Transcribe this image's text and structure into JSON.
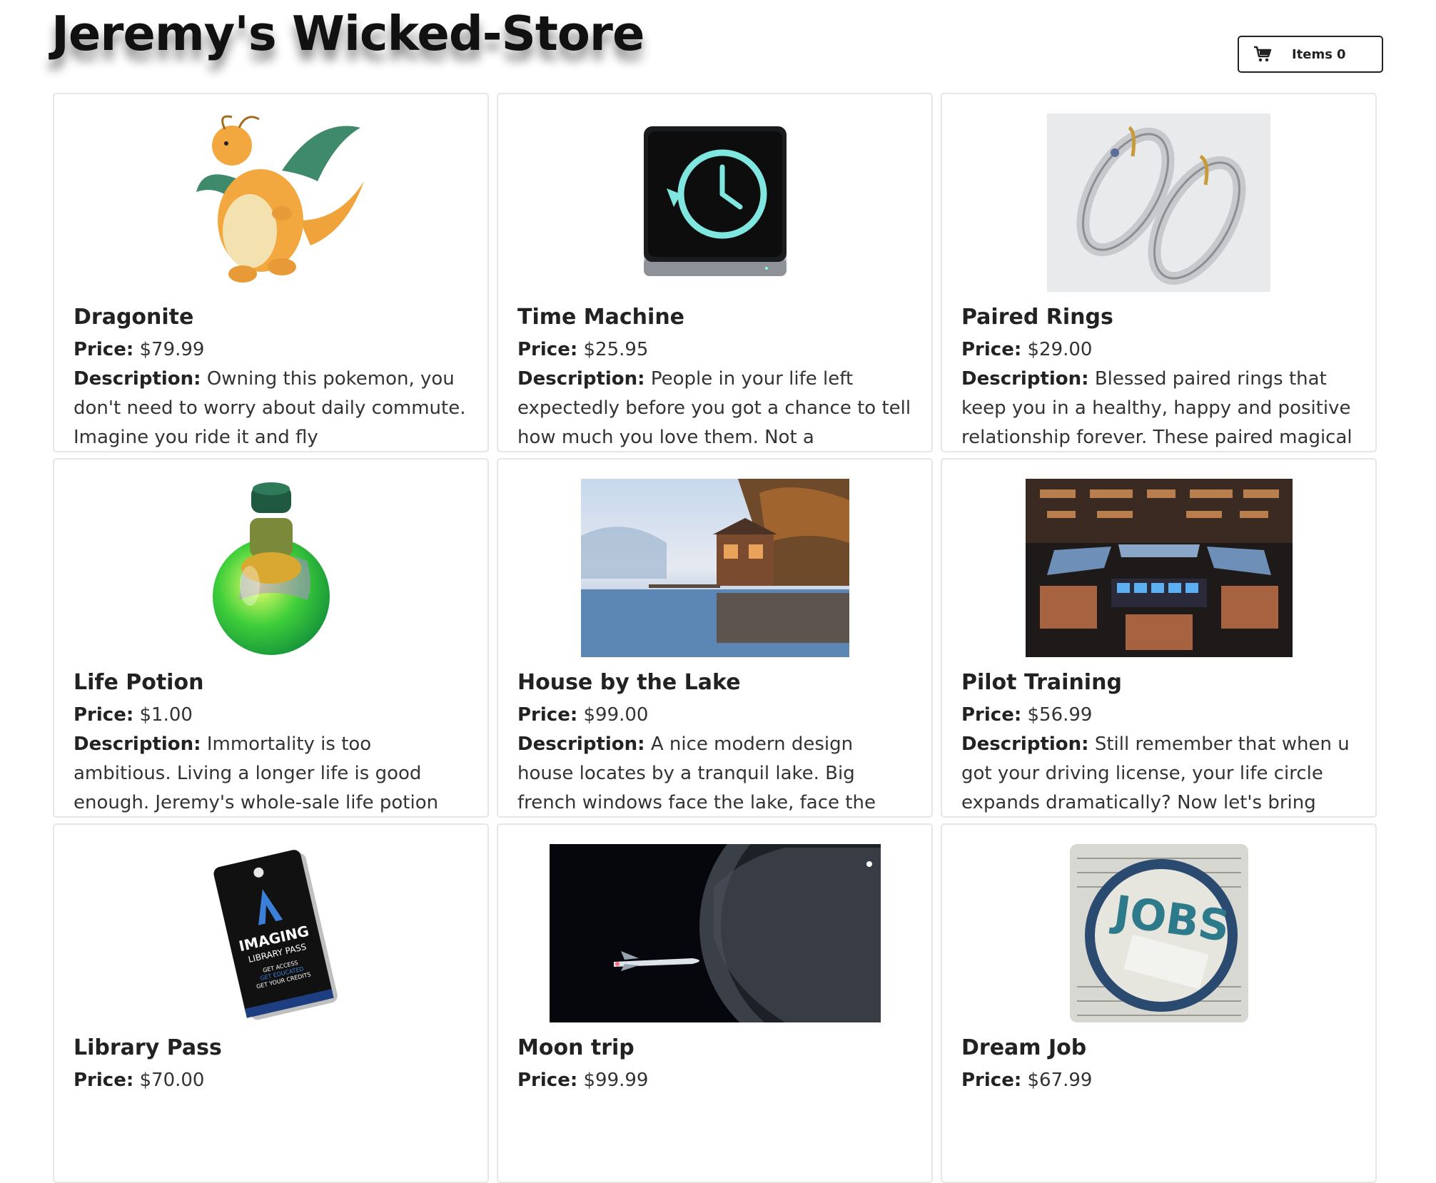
{
  "header": {
    "title": "Jeremy's Wicked-Store",
    "cart": {
      "icon": "cart-icon",
      "label": "Items",
      "count": "0"
    }
  },
  "labels": {
    "price": "Price:",
    "description": "Description:"
  },
  "products": [
    {
      "name": "Dragonite",
      "price": "$79.99",
      "description": "Owning this pokemon, you don't need to worry about daily commute. Imagine you ride it and fly",
      "image": "dragonite-image"
    },
    {
      "name": "Time Machine",
      "price": "$25.95",
      "description": "People in your life left expectedly before you got a chance to tell how much you love them. Not a",
      "image": "time-machine-image"
    },
    {
      "name": "Paired Rings",
      "price": "$29.00",
      "description": "Blessed paired rings that keep you in a healthy, happy and positive relationship forever. These paired magical",
      "image": "paired-rings-image"
    },
    {
      "name": "Life Potion",
      "price": "$1.00",
      "description": "Immortality is too ambitious. Living a longer life is good enough. Jeremy's whole-sale life potion can help",
      "image": "life-potion-image"
    },
    {
      "name": "House by the Lake",
      "price": "$99.00",
      "description": "A nice modern design house locates by a tranquil lake. Big french windows face the lake, face the serenity.",
      "image": "lake-house-image"
    },
    {
      "name": "Pilot Training",
      "price": "$56.99",
      "description": "Still remember that when u got your driving license, your life circle expands dramatically? Now let's bring",
      "image": "cockpit-image"
    },
    {
      "name": "Library Pass",
      "price": "$70.00",
      "description": "",
      "image": "library-pass-image",
      "pass_text": {
        "line1": "IMAGING",
        "line2": "LIBRARY PASS",
        "line3": "GET ACCESS",
        "line4": "GET EDUCATED",
        "line5": "GET YOUR CREDITS"
      }
    },
    {
      "name": "Moon trip",
      "price": "$99.99",
      "description": "",
      "image": "moon-trip-image"
    },
    {
      "name": "Dream Job",
      "price": "$67.99",
      "description": "",
      "image": "dream-job-image",
      "jobs_text": "JOBS"
    }
  ]
}
